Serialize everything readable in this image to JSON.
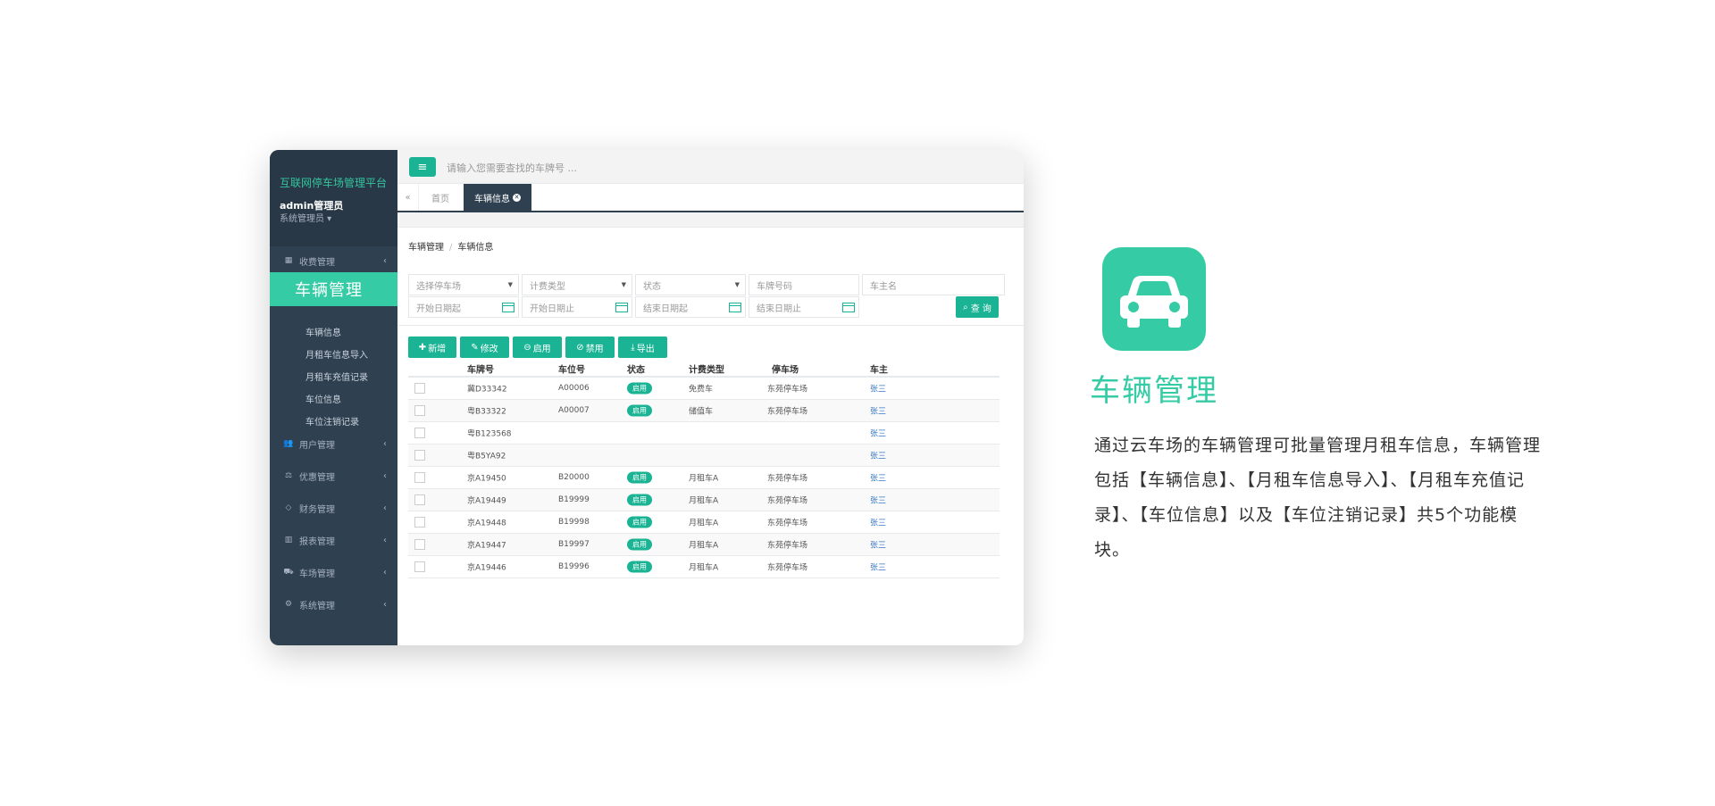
{
  "sidebar": {
    "brand": "互联网停车场管理平台",
    "admin_name": "admin管理员",
    "role": "系统管理员 ▾",
    "active_menu_label": "车辆管理",
    "menu_items": [
      {
        "label": "收费管理",
        "icon": "grid-icon"
      },
      {
        "label": "用户管理",
        "icon": "users-icon"
      },
      {
        "label": "优惠管理",
        "icon": "scale-icon"
      },
      {
        "label": "财务管理",
        "icon": "diamond-icon"
      },
      {
        "label": "报表管理",
        "icon": "bar-chart-icon"
      },
      {
        "label": "车场管理",
        "icon": "car-icon"
      },
      {
        "label": "系统管理",
        "icon": "cogs-icon"
      }
    ],
    "sub_items": [
      "车辆信息",
      "月租车信息导入",
      "月租车充值记录",
      "车位信息",
      "车位注销记录"
    ]
  },
  "topbar": {
    "menu_icon": "menu-icon",
    "search_placeholder": "请输入您需要查找的车牌号 ..."
  },
  "tabs": {
    "home": "首页",
    "active": "车辆信息"
  },
  "breadcrumb": {
    "parent": "车辆管理",
    "separator": "/",
    "current": "车辆信息"
  },
  "filters": {
    "parking_lot": "选择停车场",
    "billing_type": "计费类型",
    "status": "状态",
    "plate": "车牌号码",
    "owner": "车主名",
    "start_from": "开始日期起",
    "start_to": "开始日期止",
    "end_from": "结束日期起",
    "end_to": "结束日期止",
    "query_button": "查 询"
  },
  "toolbar": {
    "add": "新增",
    "edit": "修改",
    "enable": "启用",
    "disable": "禁用",
    "export": "导出"
  },
  "table": {
    "headers": [
      "车牌号",
      "车位号",
      "状态",
      "计费类型",
      "停车场",
      "车主"
    ],
    "rows": [
      {
        "plate": "冀D33342",
        "spot": "A00006",
        "status": "启用",
        "type": "免费车",
        "lot": "东苑停车场",
        "owner": "张三"
      },
      {
        "plate": "粤B33322",
        "spot": "A00007",
        "status": "启用",
        "type": "储值车",
        "lot": "东苑停车场",
        "owner": "张三"
      },
      {
        "plate": "粤B123568",
        "spot": "",
        "status": "",
        "type": "",
        "lot": "",
        "owner": "张三"
      },
      {
        "plate": "粤B5YA92",
        "spot": "",
        "status": "",
        "type": "",
        "lot": "",
        "owner": "张三"
      },
      {
        "plate": "京A19450",
        "spot": "B20000",
        "status": "启用",
        "type": "月租车A",
        "lot": "东苑停车场",
        "owner": "张三"
      },
      {
        "plate": "京A19449",
        "spot": "B19999",
        "status": "启用",
        "type": "月租车A",
        "lot": "东苑停车场",
        "owner": "张三"
      },
      {
        "plate": "京A19448",
        "spot": "B19998",
        "status": "启用",
        "type": "月租车A",
        "lot": "东苑停车场",
        "owner": "张三"
      },
      {
        "plate": "京A19447",
        "spot": "B19997",
        "status": "启用",
        "type": "月租车A",
        "lot": "东苑停车场",
        "owner": "张三"
      },
      {
        "plate": "京A19446",
        "spot": "B19996",
        "status": "启用",
        "type": "月租车A",
        "lot": "东苑停车场",
        "owner": "张三"
      }
    ]
  },
  "feature": {
    "icon": "car-icon",
    "title": "车辆管理",
    "description": "通过云车场的车辆管理可批量管理月租车信息，车辆管理包括【车辆信息】、【月租车信息导入】、【月租车充值记录】、【车位信息】以及【车位注销记录】共5个功能模块。"
  },
  "colors": {
    "accent": "#35cba5",
    "sidebar": "#2f4050",
    "button": "#1ab394"
  }
}
